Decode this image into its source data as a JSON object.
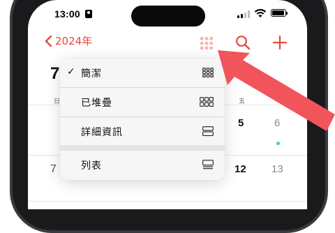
{
  "status_bar": {
    "time": "13:00"
  },
  "nav": {
    "back_label": "2024年"
  },
  "calendar": {
    "big_digit": "7",
    "big_digit_2": "7",
    "weekday_left": "日",
    "weekday_fri": "五",
    "row1": {
      "fri": "5",
      "sat": "6"
    },
    "row2": {
      "fri": "12",
      "sat": "13"
    }
  },
  "menu": {
    "items": [
      {
        "label": "簡潔",
        "checked": "✓",
        "icon": "grid-3x3-icon"
      },
      {
        "label": "已堆疊",
        "checked": "",
        "icon": "grid-stacked-icon"
      },
      {
        "label": "詳細資訊",
        "checked": "",
        "icon": "rows-detail-icon"
      },
      {
        "label": "列表",
        "checked": "",
        "icon": "list-icon"
      }
    ]
  },
  "colors": {
    "accent": "#e5493a",
    "arrow": "#f2545b",
    "event_dot": "#4cd964"
  }
}
